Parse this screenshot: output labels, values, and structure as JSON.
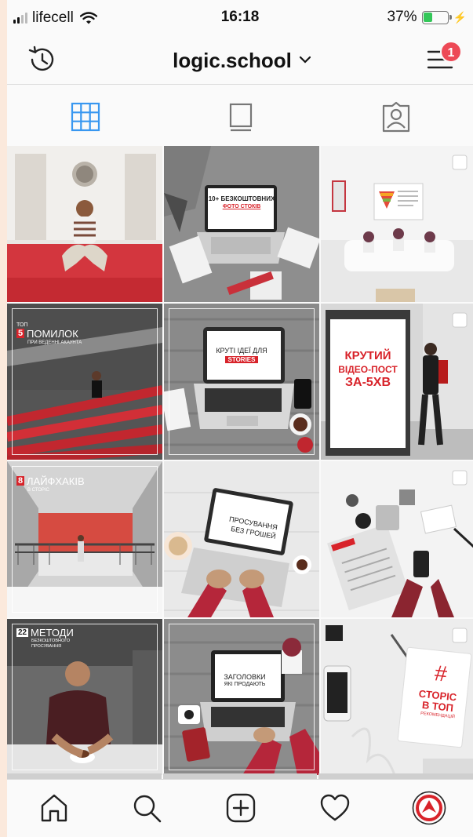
{
  "status_bar": {
    "carrier": "lifecell",
    "time": "16:18",
    "battery_percent": "37%",
    "battery_level": 0.37,
    "battery_color": "#34c759"
  },
  "header": {
    "username": "logic.school",
    "history_icon": "history-icon",
    "dropdown_icon": "chevron-down-icon",
    "menu_icon": "hamburger-menu-icon",
    "notification_count": "1"
  },
  "tabs": [
    {
      "icon": "grid-icon",
      "active": true
    },
    {
      "icon": "feed-icon",
      "active": false
    },
    {
      "icon": "tagged-icon",
      "active": false
    }
  ],
  "posts": {
    "p2": {
      "line1": "10+ БЕЗКОШТОВНИХ",
      "line2": "ФОТО СТОКІВ"
    },
    "p4": {
      "prefix": "ТОП",
      "num": "5",
      "title": "ПОМИЛОК",
      "sub": "ПРИ ВЕДЕННІ АКАУНТА"
    },
    "p5": {
      "line1": "КРУТІ ІДЕЇ ДЛЯ",
      "line2": "STORIES"
    },
    "p6": {
      "line1": "КРУТИЙ",
      "line2": "ВІДЕО-ПОСТ",
      "line3": "ЗА-5ХВ"
    },
    "p7": {
      "num": "8",
      "title": "ЛАЙФХАКІВ",
      "sub": "В СТОРІС"
    },
    "p8": {
      "line1": "ПРОСУВАННЯ",
      "line2": "БЕЗ ГРОШЕЙ"
    },
    "p10": {
      "num": "22",
      "title": "МЕТОДИ",
      "sub1": "БЕЗКОШТОВНОГО",
      "sub2": "ПРОСУВАННЯ"
    },
    "p11": {
      "line1": "ЗАГОЛОВКИ",
      "line2": "ЯКІ ПРОДАЮТЬ"
    },
    "p12": {
      "hash": "#",
      "line1": "СТОРІС",
      "line2": "В ТОП",
      "line3": "РЕКОМЕНДАЦІЙ"
    }
  },
  "bottom_nav": [
    {
      "icon": "home-icon"
    },
    {
      "icon": "search-icon"
    },
    {
      "icon": "add-post-icon"
    },
    {
      "icon": "heart-icon"
    },
    {
      "icon": "profile-avatar"
    }
  ],
  "colors": {
    "accent": "#3897f0",
    "badge": "#ed4956",
    "brand_red": "#d8232a"
  }
}
